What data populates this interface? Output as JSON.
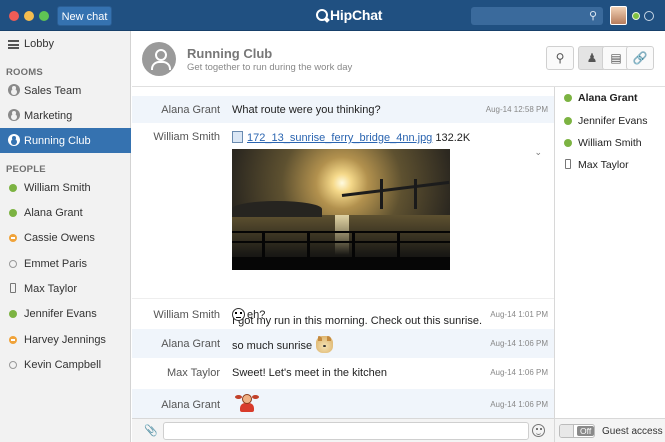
{
  "titlebar": {
    "new_chat": "New chat",
    "brand": "HipChat",
    "icons": [
      "close-dot",
      "minimize-dot",
      "zoom-dot",
      "search-icon",
      "avatar",
      "status-dot"
    ]
  },
  "sidebar": {
    "lobby": "Lobby",
    "rooms_heading": "ROOMS",
    "rooms": [
      {
        "label": "Sales Team"
      },
      {
        "label": "Marketing"
      },
      {
        "label": "Running Club",
        "active": true
      }
    ],
    "people_heading": "PEOPLE",
    "people": [
      {
        "label": "William Smith",
        "status": "available"
      },
      {
        "label": "Alana Grant",
        "status": "available"
      },
      {
        "label": "Cassie Owens",
        "status": "dnd"
      },
      {
        "label": "Emmet Paris",
        "status": "offline"
      },
      {
        "label": "Max Taylor",
        "status": "mobile"
      },
      {
        "label": "Jennifer Evans",
        "status": "available"
      },
      {
        "label": "Harvey Jennings",
        "status": "dnd"
      },
      {
        "label": "Kevin Campbell",
        "status": "offline"
      }
    ]
  },
  "room": {
    "title": "Running Club",
    "topic": "Get together to run during the work day",
    "buttons": [
      "search-icon",
      "person-icon",
      "file-icon",
      "link-icon"
    ]
  },
  "messages": [
    {
      "who": "Alana Grant",
      "text": "What route were you thinking?",
      "time": "Aug-14 12:58 PM"
    },
    {
      "who": "William Smith",
      "file_name": "172_13_sunrise_ferry_bridge_4nn.jpg",
      "file_size": "132.2K",
      "caption": "I got my run in this morning. Check out this sunrise."
    },
    {
      "who": "William Smith",
      "text": "eh?",
      "time": "Aug-14 1:01 PM"
    },
    {
      "who": "Alana Grant",
      "text": "so much sunrise",
      "time": "Aug-14 1:06 PM"
    },
    {
      "who": "Max Taylor",
      "text": "Sweet! Let's meet in the kitchen",
      "time": "Aug-14 1:06 PM"
    },
    {
      "who": "Alana Grant",
      "text": "",
      "time": "Aug-14 1:06 PM"
    }
  ],
  "input": {
    "value": "",
    "placeholder": ""
  },
  "roster": [
    {
      "name": "Alana Grant",
      "status": "available",
      "bold": true
    },
    {
      "name": "Jennifer Evans",
      "status": "available"
    },
    {
      "name": "William Smith",
      "status": "available"
    },
    {
      "name": "Max Taylor",
      "status": "mobile"
    }
  ],
  "guest": {
    "toggle": "Off",
    "label": "Guest access"
  },
  "colors": {
    "header": "#205081",
    "accent": "#3572b0",
    "available": "#7cb342",
    "dnd": "#f0a33a"
  }
}
